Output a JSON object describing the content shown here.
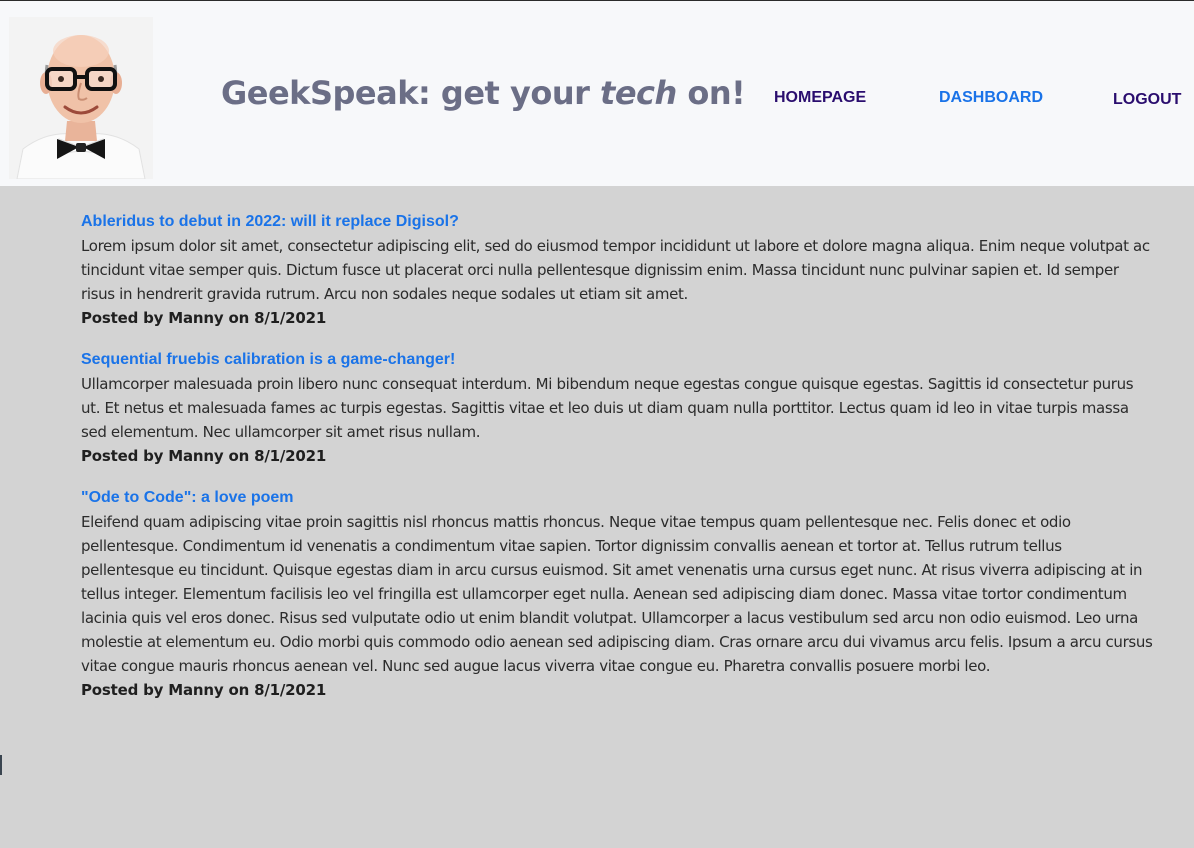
{
  "header": {
    "title_prefix": "GeekSpeak: get your ",
    "title_emphasis": "tech",
    "title_suffix": " on!",
    "avatar_icon": "bald-man-glasses-bowtie-avatar"
  },
  "nav": {
    "homepage": "HOMEPAGE",
    "dashboard": "DASHBOARD",
    "logout": "LOGOUT",
    "colors": {
      "default": "#2a0d6e",
      "active": "#1a73e8"
    }
  },
  "posts": [
    {
      "title": "Ableridus to debut in 2022: will it replace Digisol?",
      "body": "Lorem ipsum dolor sit amet, consectetur adipiscing elit, sed do eiusmod tempor incididunt ut labore et dolore magna aliqua. Enim neque volutpat ac tincidunt vitae semper quis. Dictum fusce ut placerat orci nulla pellentesque dignissim enim. Massa tincidunt nunc pulvinar sapien et. Id semper risus in hendrerit gravida rutrum. Arcu non sodales neque sodales ut etiam sit amet.",
      "meta": "Posted by Manny on 8/1/2021"
    },
    {
      "title": "Sequential fruebis calibration is a game-changer!",
      "body": "Ullamcorper malesuada proin libero nunc consequat interdum. Mi bibendum neque egestas congue quisque egestas. Sagittis id consectetur purus ut. Et netus et malesuada fames ac turpis egestas. Sagittis vitae et leo duis ut diam quam nulla porttitor. Lectus quam id leo in vitae turpis massa sed elementum. Nec ullamcorper sit amet risus nullam.",
      "meta": "Posted by Manny on 8/1/2021"
    },
    {
      "title": "\"Ode to Code\": a love poem",
      "body": "Eleifend quam adipiscing vitae proin sagittis nisl rhoncus mattis rhoncus. Neque vitae tempus quam pellentesque nec. Felis donec et odio pellentesque. Condimentum id venenatis a condimentum vitae sapien. Tortor dignissim convallis aenean et tortor at. Tellus rutrum tellus pellentesque eu tincidunt. Quisque egestas diam in arcu cursus euismod. Sit amet venenatis urna cursus eget nunc. At risus viverra adipiscing at in tellus integer. Elementum facilisis leo vel fringilla est ullamcorper eget nulla. Aenean sed adipiscing diam donec. Massa vitae tortor condimentum lacinia quis vel eros donec. Risus sed vulputate odio ut enim blandit volutpat. Ullamcorper a lacus vestibulum sed arcu non odio euismod. Leo urna molestie at elementum eu. Odio morbi quis commodo odio aenean sed adipiscing diam. Cras ornare arcu dui vivamus arcu felis. Ipsum a arcu cursus vitae congue mauris rhoncus aenean vel. Nunc sed augue lacus viverra vitae congue eu. Pharetra convallis posuere morbi leo.",
      "meta": "Posted by Manny on 8/1/2021"
    }
  ],
  "colors": {
    "page_background": "#d3d3d3",
    "header_background": "#f7f8fa",
    "title_color": "#6b6e86",
    "link_blue": "#1a73e8"
  }
}
